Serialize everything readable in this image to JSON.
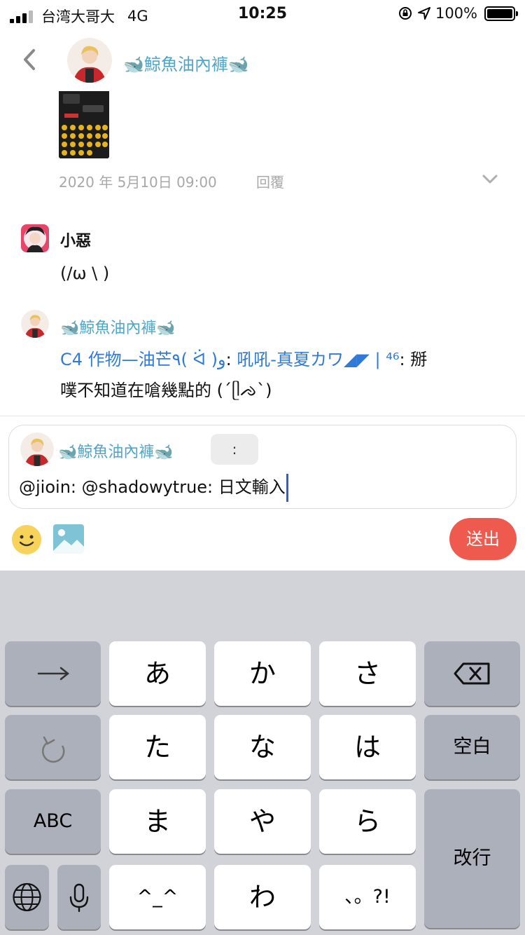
{
  "status": {
    "carrier": "台湾大哥大",
    "network": "4G",
    "time": "10:25",
    "battery": "100%",
    "battery_level": 1.0
  },
  "header": {
    "title": "🐋鯨魚油內褲🐋"
  },
  "message_top": {
    "text": "‥ ‥ ‥",
    "timestamp": "2020 年 5月10日 09:00",
    "reply_label": "回覆"
  },
  "message_1": {
    "author": "小惡",
    "text": "(/ω \\ )"
  },
  "message_2": {
    "author": "🐋鯨魚油內褲🐋",
    "mention": "C4 作物—油芒٩( ᐛ )و",
    "line1_mid": ": ",
    "mention2": "吼吼-真夏カワ◢◤ | ⁴⁶",
    "line1_end": ": 掰",
    "line2": "噗不知道在嗆幾點的 (´ᥫᨌ`)"
  },
  "compose": {
    "author": "🐋鯨魚油內褲🐋",
    "reaction": ":",
    "value": "@jioin: @shadowytrue: 日文輸入"
  },
  "actions": {
    "send_label": "送出"
  },
  "keyboard": {
    "rows": [
      [
        "→",
        "あ",
        "か",
        "さ",
        "⌫"
      ],
      [
        "↺",
        "た",
        "な",
        "は",
        "空白"
      ],
      [
        "ABC",
        "ま",
        "や",
        "ら",
        "改行"
      ],
      [
        "🌐",
        "🎤",
        "^^",
        "わ",
        "、。?!"
      ]
    ],
    "space_label": "空白",
    "return_label": "改行",
    "abc_label": "ABC",
    "emoticon_label": "^_^",
    "punct_label": "、。?!"
  },
  "colors": {
    "accent": "#4fa6c8",
    "mention": "#2f7ad8",
    "send": "#ef5a4e",
    "keyboard_bg": "#d1d3d9"
  }
}
